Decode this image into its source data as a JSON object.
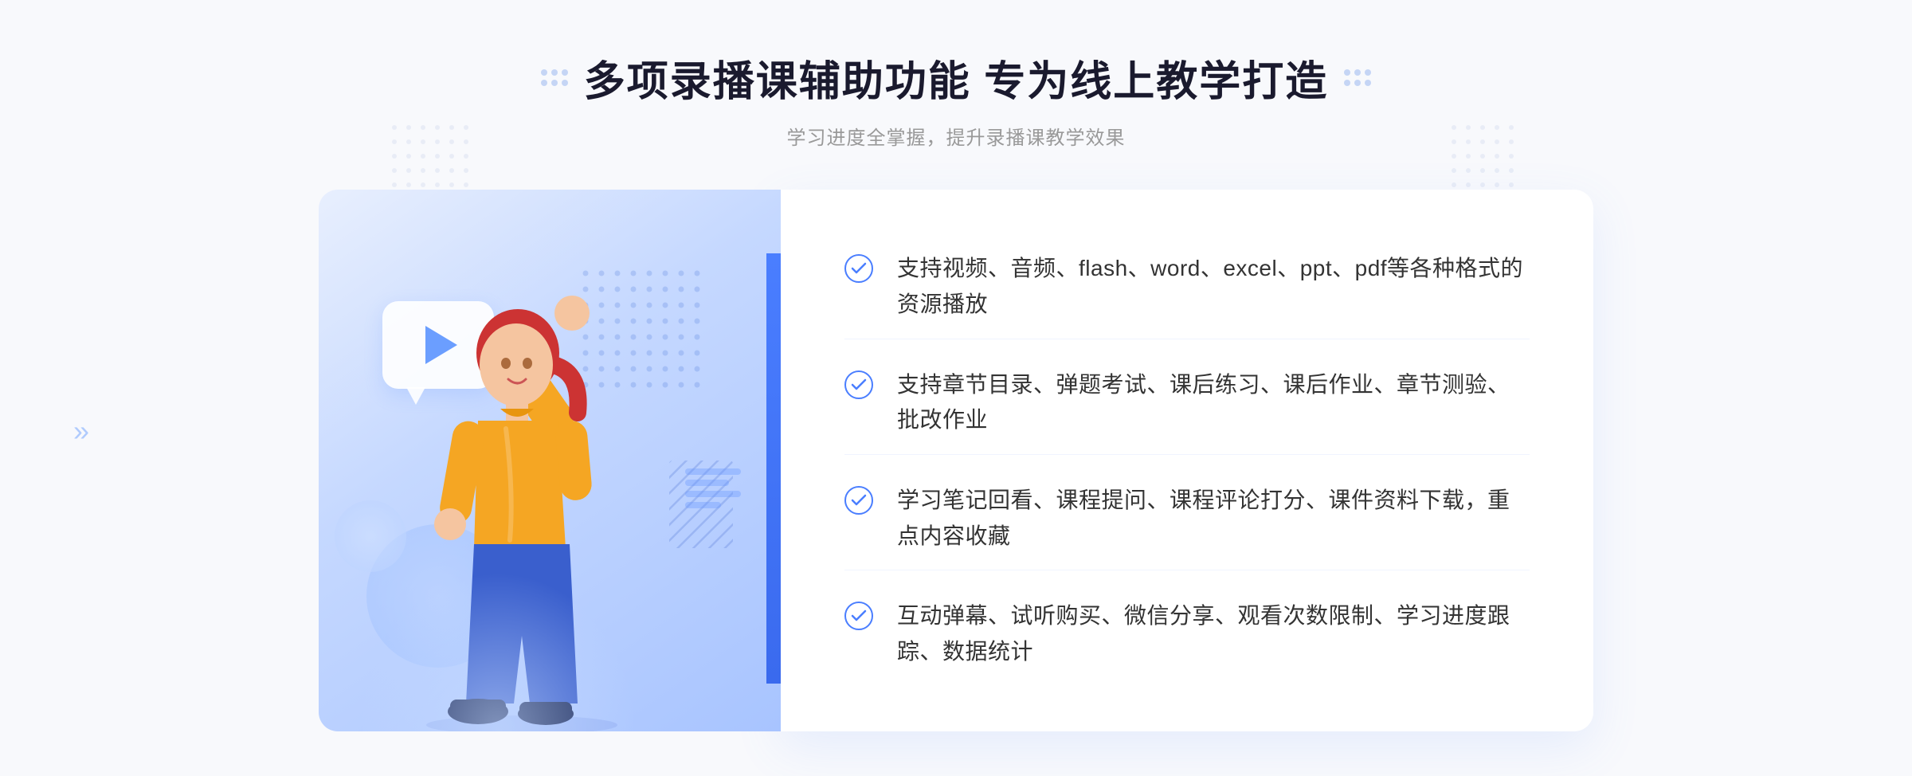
{
  "page": {
    "background_color": "#f8f9fc"
  },
  "header": {
    "title": "多项录播课辅助功能 专为线上教学打造",
    "subtitle": "学习进度全掌握，提升录播课教学效果",
    "title_decorator_left": "❖",
    "title_decorator_right": "❖"
  },
  "features": [
    {
      "id": 1,
      "text": "支持视频、音频、flash、word、excel、ppt、pdf等各种格式的资源播放"
    },
    {
      "id": 2,
      "text": "支持章节目录、弹题考试、课后练习、课后作业、章节测验、批改作业"
    },
    {
      "id": 3,
      "text": "学习笔记回看、课程提问、课程评论打分、课件资料下载，重点内容收藏"
    },
    {
      "id": 4,
      "text": "互动弹幕、试听购买、微信分享、观看次数限制、学习进度跟踪、数据统计"
    }
  ],
  "decorations": {
    "chevrons": "»",
    "play_button": "▶"
  }
}
